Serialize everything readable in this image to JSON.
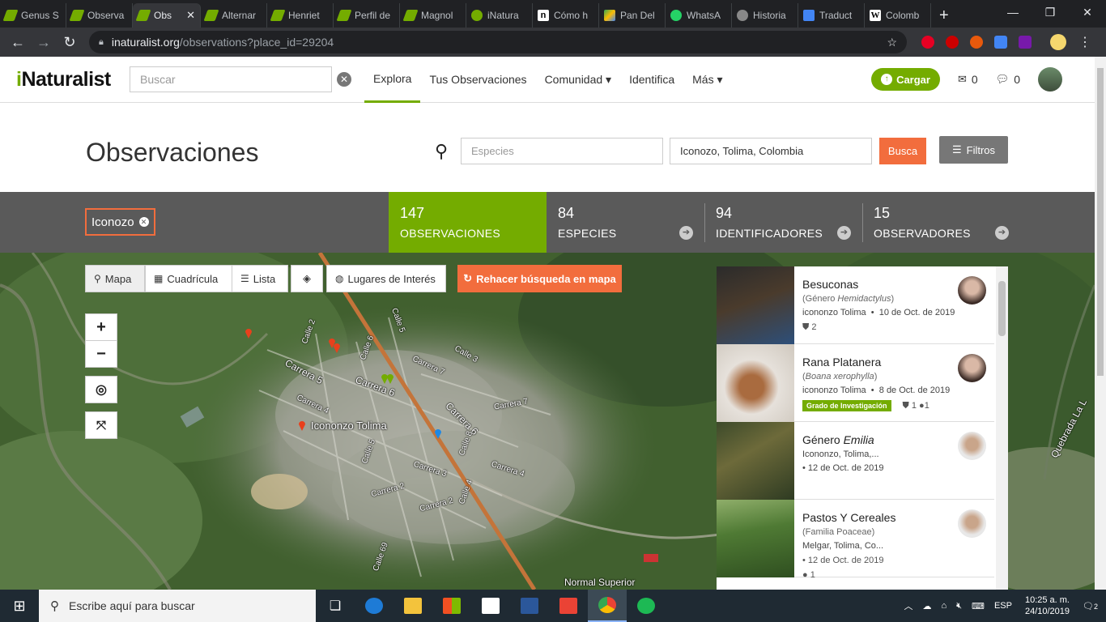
{
  "browser": {
    "tabs": [
      {
        "title": "Genus S",
        "icon": "inat-leaf-icon"
      },
      {
        "title": "Observa",
        "icon": "inat-leaf-icon"
      },
      {
        "title": "Obs",
        "icon": "inat-leaf-icon",
        "active": true
      },
      {
        "title": "Alternar",
        "icon": "inat-leaf-icon"
      },
      {
        "title": "Henriet",
        "icon": "inat-leaf-icon"
      },
      {
        "title": "Perfil de",
        "icon": "inat-leaf-icon"
      },
      {
        "title": "Magnol",
        "icon": "inat-leaf-icon"
      },
      {
        "title": "iNatura",
        "icon": "inat-bird-icon"
      },
      {
        "title": "Cómo h",
        "icon": "notion-icon"
      },
      {
        "title": "Pan Del",
        "icon": "maps-icon"
      },
      {
        "title": "WhatsA",
        "icon": "whatsapp-icon"
      },
      {
        "title": "Historia",
        "icon": "history-icon"
      },
      {
        "title": "Traduct",
        "icon": "translate-icon"
      },
      {
        "title": "Colomb",
        "icon": "wikipedia-icon"
      }
    ],
    "url_host": "inaturalist.org",
    "url_path": "/observations?place_id=29204"
  },
  "header": {
    "logo_i": "i",
    "logo_rest": "Naturalist",
    "search_placeholder": "Buscar",
    "nav": [
      {
        "label": "Explora"
      },
      {
        "label": "Tus Observaciones"
      },
      {
        "label": "Comunidad ▾"
      },
      {
        "label": "Identifica"
      },
      {
        "label": "Más ▾"
      }
    ],
    "upload_label": "Cargar",
    "messages_count": "0",
    "comments_count": "0"
  },
  "page": {
    "title": "Observaciones",
    "species_placeholder": "Especies",
    "place_value": "Iconozo, Tolima, Colombia",
    "search_btn": "Busca",
    "filters_btn": "Filtros"
  },
  "stats": {
    "place_pill": "Iconozo",
    "observations": {
      "num": "147",
      "label": "OBSERVACIONES"
    },
    "species": {
      "num": "84",
      "label": "ESPECIES"
    },
    "identifiers": {
      "num": "94",
      "label": "IDENTIFICADORES"
    },
    "observers": {
      "num": "15",
      "label": "OBSERVADORES"
    }
  },
  "map": {
    "controls": {
      "mapa": "Mapa",
      "cuadricula": "Cuadrícula",
      "lista": "Lista",
      "lugares": "Lugares de Interés",
      "redo": "Rehacer búsqueda en mapa"
    },
    "labels": {
      "town": "Icononzo Tolima",
      "carrera5": "Carrera 5",
      "carrera6": "Carrera 6",
      "carrera7": "Carrera 7",
      "carrera7b": "Carrera 7",
      "carrera4": "Carrera 4",
      "carrera4b": "Carrera 4",
      "carrera3": "Carrera 3",
      "carrera2": "Carrera 2",
      "carrera2b": "Carrera 2",
      "calle3": "Calle 3",
      "calle5": "Calle 5",
      "calle6": "Calle 6",
      "calle8": "Calle 8",
      "calle2": "Calle 2",
      "calle4": "Calle 4",
      "calle69": "Calle 69",
      "calle5b": "Calle 5",
      "school": "Normal Superior",
      "quebrada": "Quebrada La L"
    }
  },
  "observations": [
    {
      "name": "Besuconas",
      "sci_prefix": "(Género ",
      "sci_name": "Hemidactylus",
      "sci_suffix": ")",
      "place": "icononzo Tolima",
      "date": "10 de Oct. de 2019",
      "ids": "2"
    },
    {
      "name": "Rana Platanera",
      "sci_prefix": "(",
      "sci_name": "Boana xerophylla",
      "sci_suffix": ")",
      "place": "icononzo Tolima",
      "date": "8 de Oct. de 2019",
      "badge": "Grado de Investigación",
      "ids": "1",
      "comments": "1"
    },
    {
      "name_prefix": "Género ",
      "name_italic": "Emilia",
      "place": "Icononzo, Tolima,...",
      "date": "12 de Oct. de 2019"
    },
    {
      "name": "Pastos Y Cereales",
      "sci_prefix": "(Familia ",
      "sci_name": "Poaceae",
      "sci_suffix": ")",
      "place": "Melgar, Tolima, Co...",
      "date": "12 de Oct. de 2019",
      "comments": "1"
    }
  ],
  "taskbar": {
    "search_placeholder": "Escribe aquí para buscar",
    "lang": "ESP",
    "time": "10:25 a. m.",
    "date": "24/10/2019",
    "notifications": "2"
  }
}
